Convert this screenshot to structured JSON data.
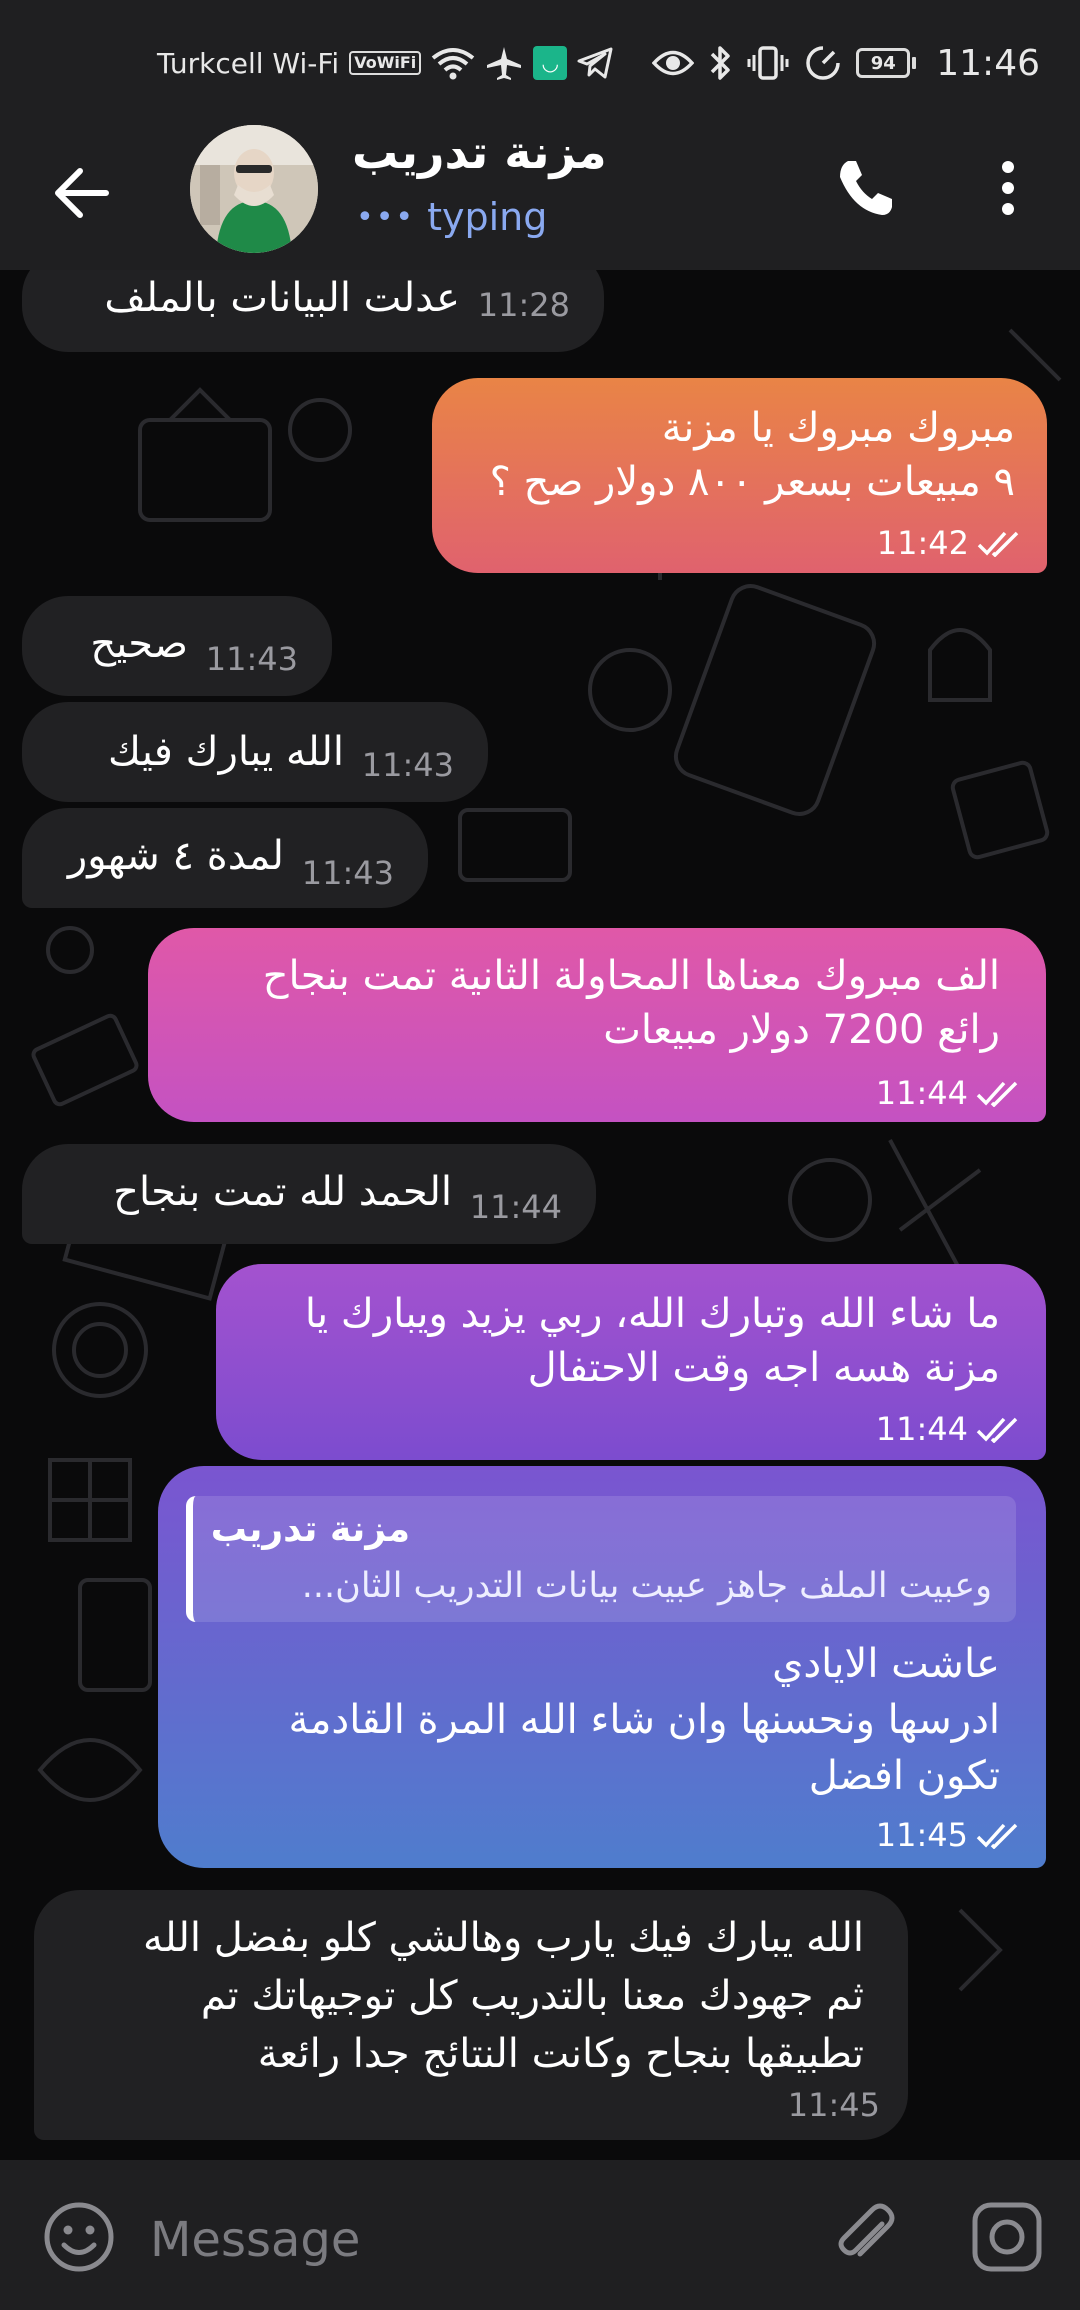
{
  "status_bar": {
    "carrier": "Turkcell Wi-Fi",
    "vowifi": "VoWiFi",
    "battery": "94",
    "time": "11:46"
  },
  "header": {
    "title": "مزنة تدريب",
    "status": "typing"
  },
  "messages": [
    {
      "dir": "in",
      "lines": [
        "عدلت البيانات بالملف"
      ],
      "time": "11:28"
    },
    {
      "dir": "out",
      "lines": [
        "مبروك مبروك يا مزنة",
        "٩ مبيعات بسعر ٨٠٠ دولار صح ؟"
      ],
      "time": "11:42"
    },
    {
      "dir": "in",
      "lines": [
        "صحيح"
      ],
      "time": "11:43"
    },
    {
      "dir": "in",
      "lines": [
        "الله يبارك فيك"
      ],
      "time": "11:43"
    },
    {
      "dir": "in",
      "lines": [
        "لمدة ٤ شهور"
      ],
      "time": "11:43"
    },
    {
      "dir": "out",
      "lines": [
        "الف مبروك معناها المحاولة الثانية تمت بنجاح",
        "رائع 7200 دولار مبيعات"
      ],
      "time": "11:44"
    },
    {
      "dir": "in",
      "lines": [
        "الحمد لله تمت بنجاح"
      ],
      "time": "11:44"
    },
    {
      "dir": "out",
      "lines": [
        "ما شاء الله وتبارك الله، ربي يزيد ويبارك يا",
        "مزنة هسه اجه وقت الاحتفال"
      ],
      "time": "11:44"
    },
    {
      "dir": "out",
      "reply": {
        "name": "مزنة تدريب",
        "text": "وعبيت الملف جاهز عبيت بيانات التدريب الثان..."
      },
      "lines": [
        "عاشت الايادي",
        "ادرسها ونحسنها وان شاء الله المرة القادمة",
        "تكون افضل"
      ],
      "time": "11:45"
    },
    {
      "dir": "in",
      "lines": [
        "الله يبارك فيك يارب وهالشي كلو بفضل الله",
        "ثم جهودك معنا بالتدريب كل توجيهاتك تم",
        "تطبيقها بنجاح وكانت النتائج جدا رائعة"
      ],
      "time": "11:45"
    }
  ],
  "input": {
    "placeholder": "Message"
  },
  "colors": {
    "bar_bg": "#1f1f21",
    "incoming_bubble": "#212123",
    "typing_accent": "#8aa9f0",
    "outgoing_gradient": [
      "#e98a3d",
      "#d8527a",
      "#b047c8",
      "#7d4fd3",
      "#4f7fd0"
    ]
  }
}
